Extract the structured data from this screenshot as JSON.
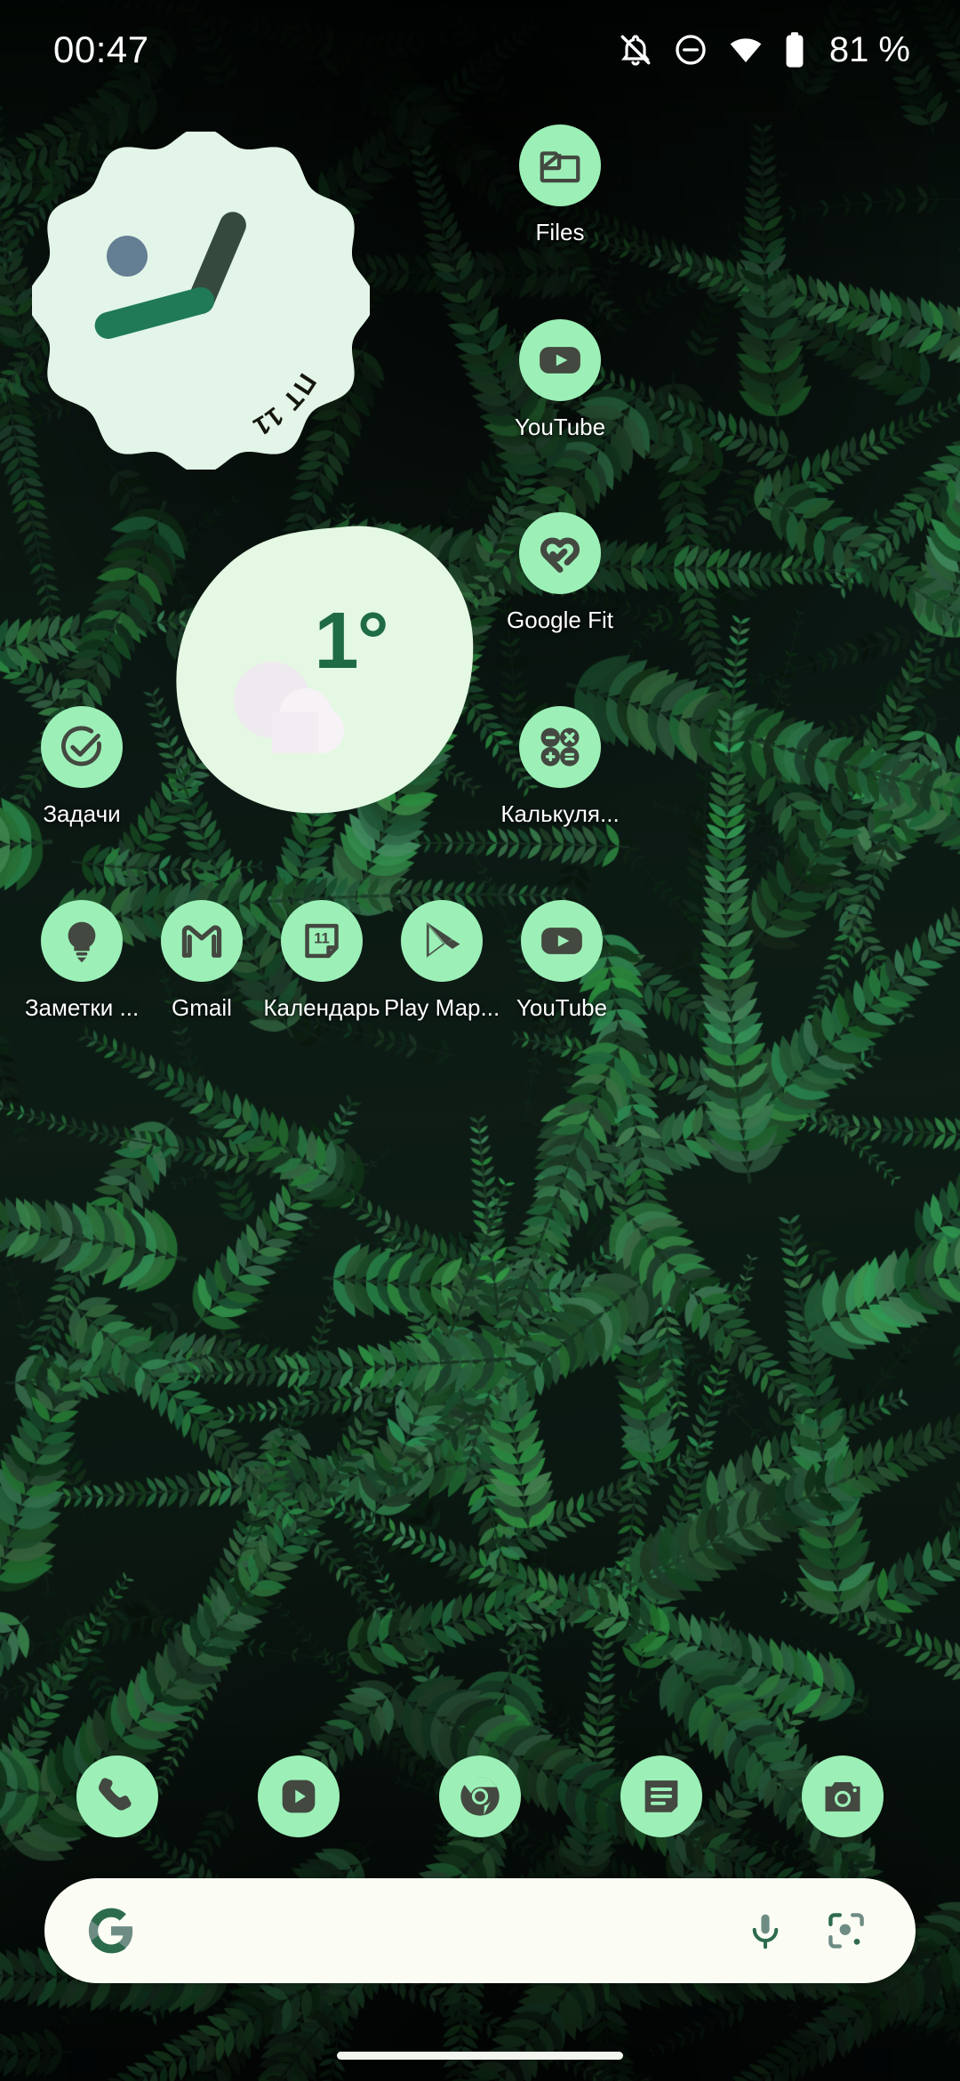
{
  "status_bar": {
    "clock": "00:47",
    "battery_percent": "81 %",
    "icons": [
      {
        "name": "notifications-silenced-icon",
        "label": "notifications muted"
      },
      {
        "name": "do-not-disturb-icon",
        "label": "do not disturb"
      },
      {
        "name": "wifi-icon",
        "label": "wifi connected"
      },
      {
        "name": "battery-icon",
        "label": "battery"
      }
    ]
  },
  "clock_widget": {
    "name": "analog-clock-widget",
    "date_text": "ПТ 11",
    "hour_hand_angle": 23,
    "minute_hand_angle": 255,
    "face_color": "#e2f5e8",
    "hour_hand_color": "#36493d",
    "minute_hand_color": "#1f7a55",
    "dot_color": "#647f93"
  },
  "weather_widget": {
    "name": "weather-widget",
    "temperature": "1°",
    "condition_icon": "cloud-icon",
    "blob_color": "#e4f8e3",
    "text_color": "#1e6b45"
  },
  "theme": {
    "icon_background": "#9cf0b7",
    "icon_glyph": "#434840",
    "label_color": "#ffffff",
    "search_background": "#fbfdf5"
  },
  "apps": {
    "right_column": [
      {
        "label": "Files",
        "icon": "files-folder-icon",
        "name": "app-files"
      },
      {
        "label": "YouTube",
        "icon": "youtube-icon",
        "name": "app-youtube-right"
      },
      {
        "label": "Google Fit",
        "icon": "heart-fit-icon",
        "name": "app-google-fit"
      },
      {
        "label": "Калькуля...",
        "icon": "calculator-icon",
        "name": "app-calculator"
      }
    ],
    "left_column": [
      {
        "label": "Задачи",
        "icon": "tasks-check-circle-icon",
        "name": "app-tasks"
      }
    ],
    "main_row": [
      {
        "label": "Заметки ...",
        "icon": "keep-bulb-icon",
        "name": "app-keep-notes"
      },
      {
        "label": "Gmail",
        "icon": "gmail-icon",
        "name": "app-gmail"
      },
      {
        "label": "Календарь",
        "icon": "calendar-icon",
        "name": "app-calendar",
        "day_number": "11"
      },
      {
        "label": "Play Мар...",
        "icon": "play-store-icon",
        "name": "app-play-store"
      },
      {
        "label": "YouTube",
        "icon": "youtube-icon",
        "name": "app-youtube-row"
      }
    ]
  },
  "dock": [
    {
      "icon": "phone-icon",
      "name": "dock-phone"
    },
    {
      "icon": "youtube-icon",
      "name": "dock-youtube"
    },
    {
      "icon": "chrome-icon",
      "name": "dock-chrome"
    },
    {
      "icon": "messages-icon",
      "name": "dock-messages"
    },
    {
      "icon": "camera-icon",
      "name": "dock-camera"
    }
  ],
  "search": {
    "google_logo": "google-g-icon",
    "mic_icon": "microphone-icon",
    "lens_icon": "google-lens-icon",
    "placeholder": ""
  },
  "navigation": {
    "gesture_pill": "home-gesture-pill"
  }
}
